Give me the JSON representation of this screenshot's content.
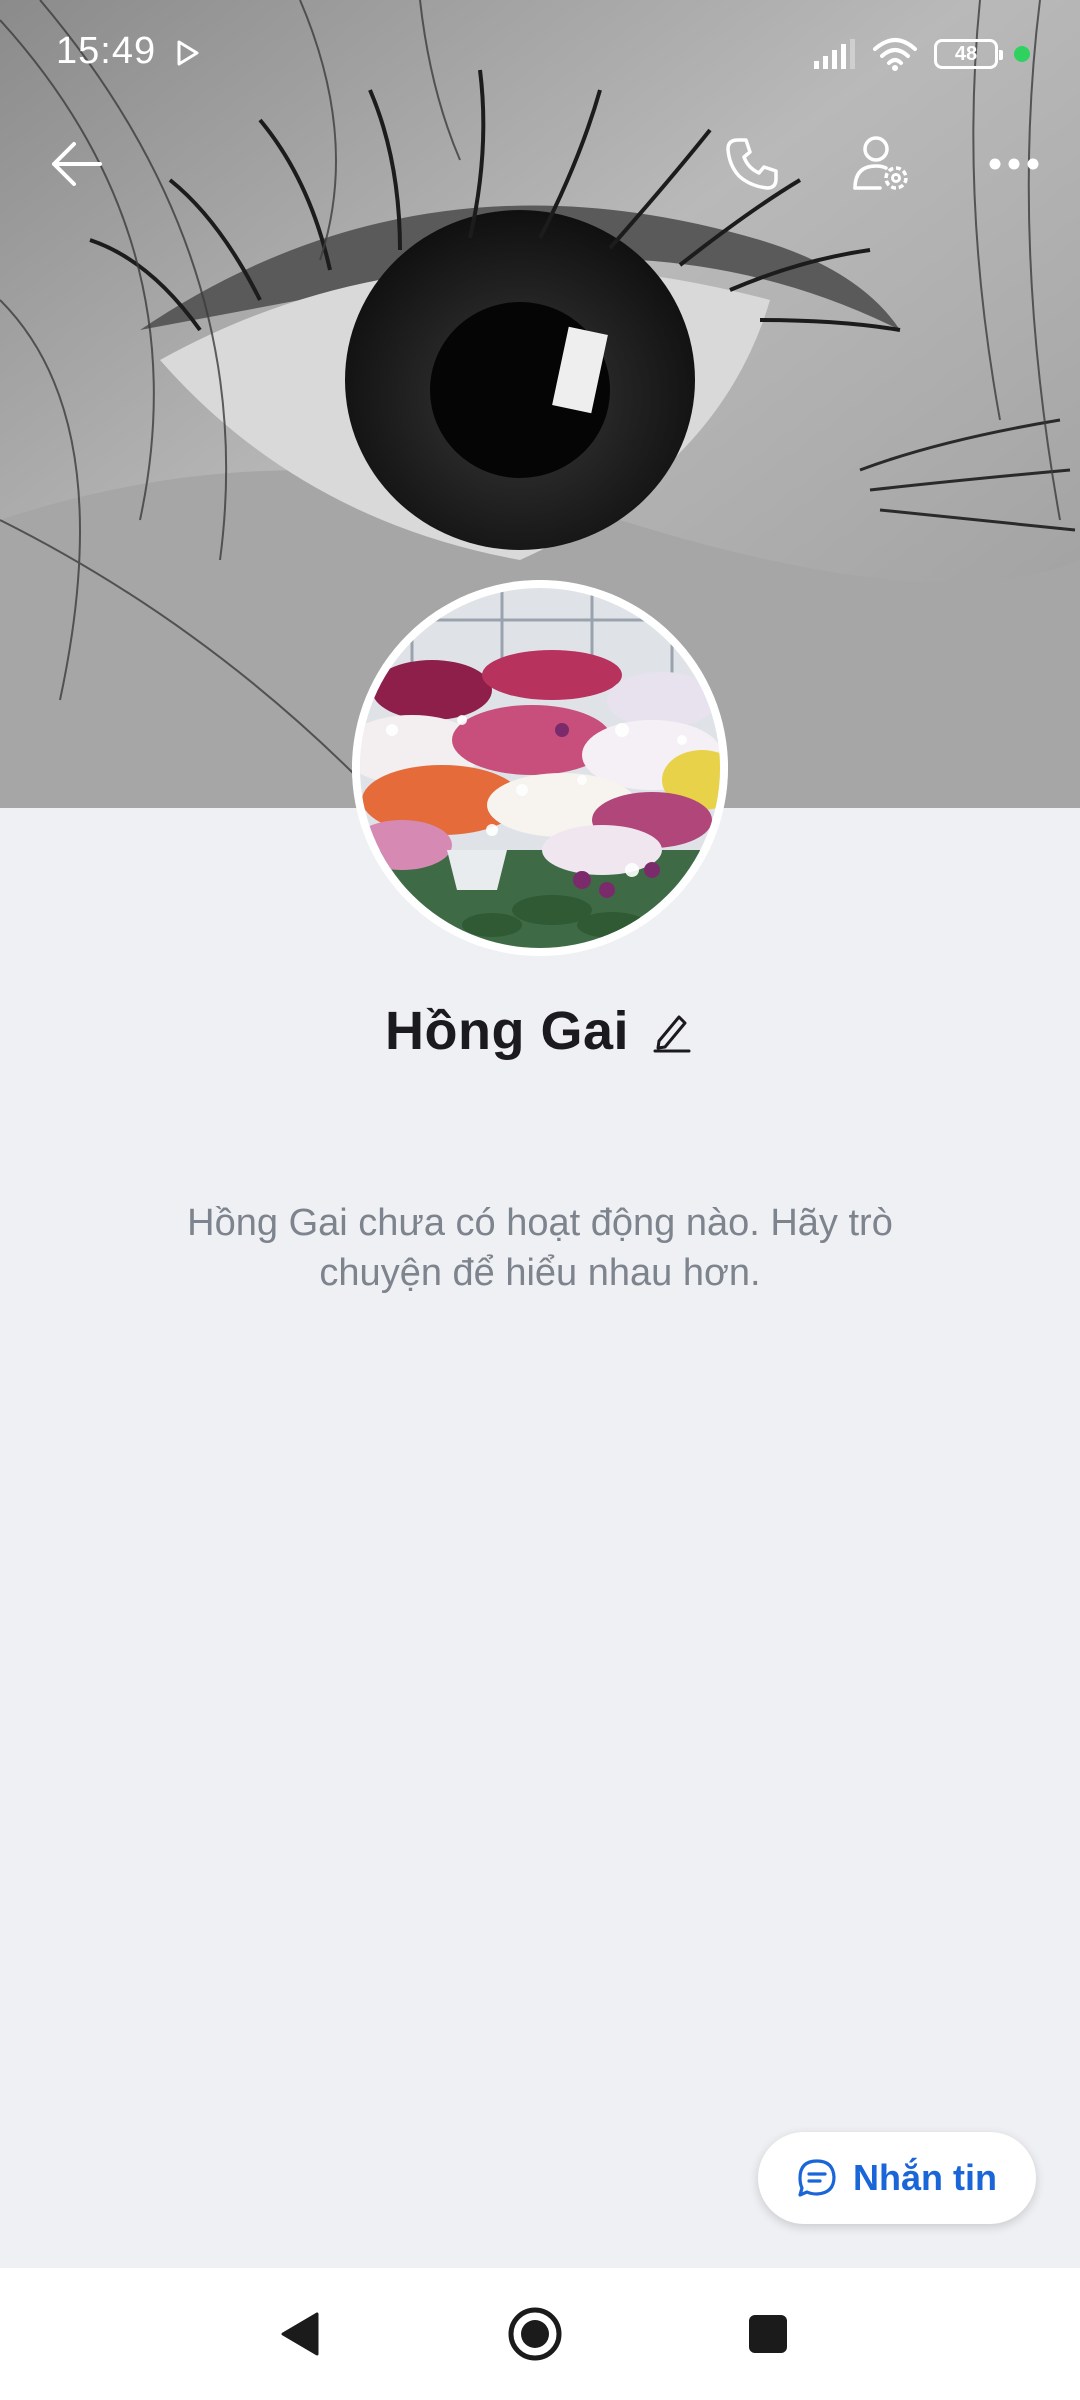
{
  "status_bar": {
    "time": "15:49",
    "battery_level": "48",
    "play_icon": "play-store-notification-icon",
    "signal_icon": "cellular-signal-icon",
    "wifi_icon": "wifi-icon",
    "privacy_indicator_color": "#2fd25e"
  },
  "top_bar": {
    "back_icon": "back-arrow-icon",
    "call_icon": "phone-icon",
    "settings_icon": "user-settings-icon",
    "more_icon": "more-dots-icon"
  },
  "profile": {
    "name": "Hồng Gai",
    "edit_icon": "edit-pencil-icon",
    "empty_message": "Hồng Gai chưa có hoạt động nào. Hãy trò chuyện để hiểu nhau hơn."
  },
  "actions": {
    "message_label": "Nhắn tin",
    "message_icon": "chat-bubble-icon",
    "accent_color": "#1a66d9"
  },
  "navigation": {
    "back": "nav-back-icon",
    "home": "nav-home-icon",
    "recents": "nav-recents-icon"
  }
}
